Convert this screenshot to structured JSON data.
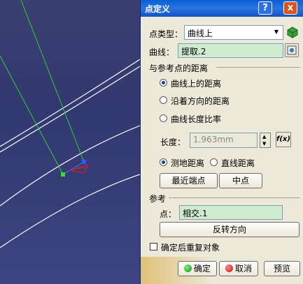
{
  "dialog": {
    "title": "点定义",
    "help_label": "?",
    "close_label": "x",
    "point_type_label": "点类型：",
    "point_type_value": "曲线上",
    "curve_label": "曲线：",
    "curve_value": "提取.2",
    "distance_group_label": "与参考点的距离",
    "radio_options": [
      "曲线上的距离",
      "沿着方向的距离",
      "曲线长度比率"
    ],
    "selected_option": 0,
    "length_label": "长度：",
    "length_value": "1.963mm",
    "fx_label": "f(x)",
    "geodesic_label": "测地距离",
    "straight_label": "直线距离",
    "nearest_end_button": "最近端点",
    "midpoint_button": "中点",
    "reference_group_label": "参考",
    "point_label": "点：",
    "point_value": "相交.1",
    "reverse_button": "反转方向",
    "repeat_label": "确定后重复对象",
    "ok_button": "确定",
    "cancel_button": "取消",
    "preview_button": "预览"
  },
  "colors": {
    "title_bar": "#0a5fd8",
    "field_bg": "#cfeccf",
    "viewport_bg": "#3a3f72"
  }
}
